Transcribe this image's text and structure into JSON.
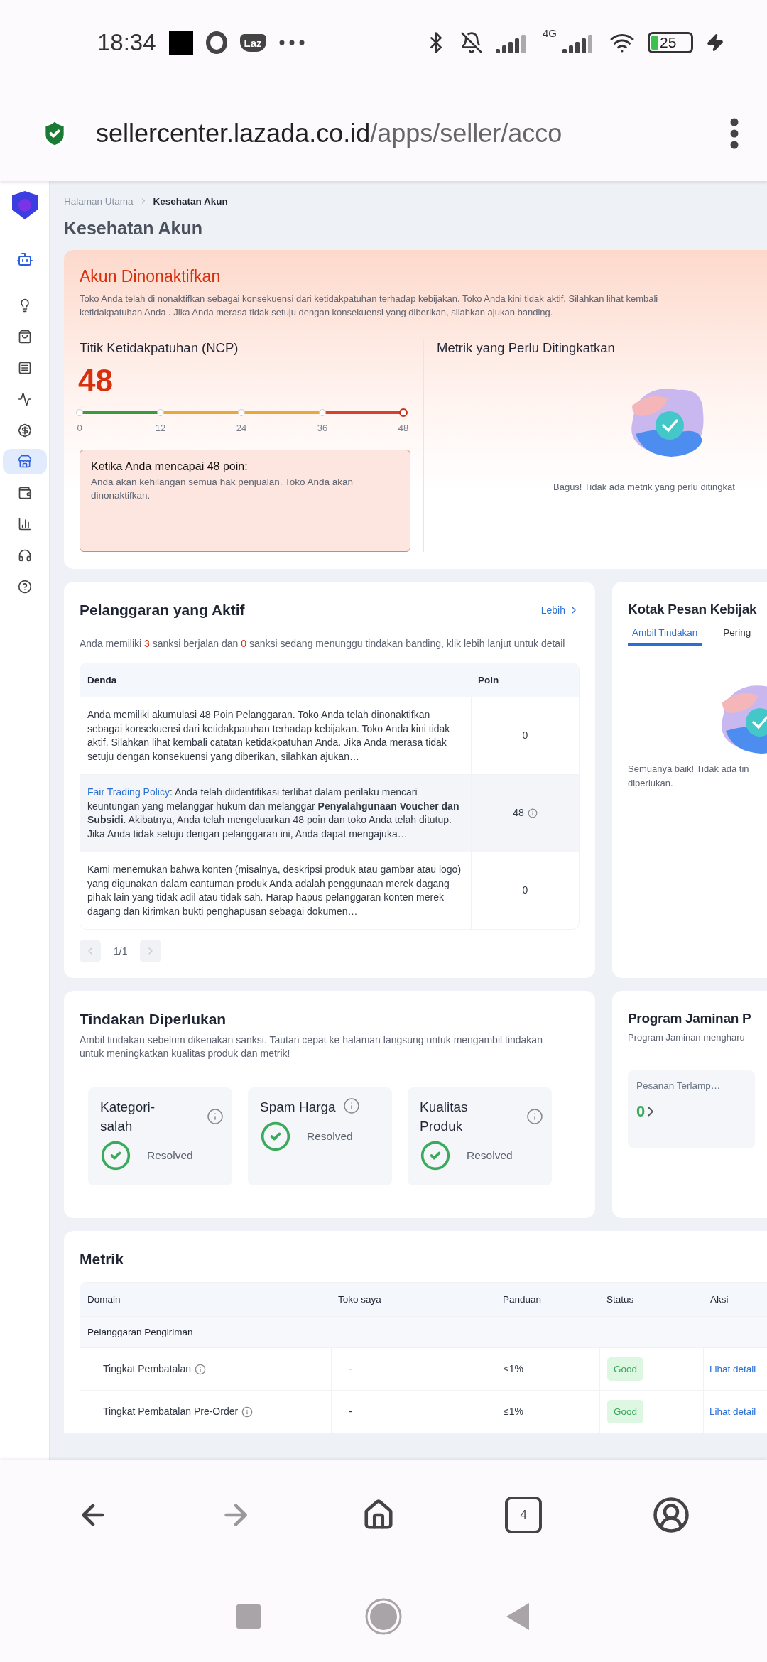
{
  "status_bar": {
    "time": "18:34",
    "app_badge": "Laz",
    "network_label": "4G",
    "battery": "25"
  },
  "address_bar": {
    "host": "sellercenter.lazada.co.id",
    "path": "/apps/seller/acco"
  },
  "sidebar": {
    "items": [
      {
        "kind": "bulb",
        "selected": false
      },
      {
        "kind": "bag",
        "selected": false
      },
      {
        "kind": "list",
        "selected": false
      },
      {
        "kind": "trend",
        "selected": false
      },
      {
        "kind": "promo",
        "selected": false
      },
      {
        "kind": "store",
        "selected": true
      },
      {
        "kind": "wallet",
        "selected": false
      },
      {
        "kind": "stats",
        "selected": false
      },
      {
        "kind": "support",
        "selected": false
      },
      {
        "kind": "help",
        "selected": false
      }
    ]
  },
  "breadcrumb": [
    "Halaman Utama",
    "Kesehatan Akun"
  ],
  "page_title": "Kesehatan Akun",
  "account_status": {
    "title": "Akun Dinonaktifkan",
    "message_lines": [
      "Toko Anda telah di nonaktifkan sebagai konsekuensi dari ketidakpatuhan terhadap kebijakan. Toko Anda kini tidak aktif. Silahkan lihat kembali",
      "ketidakpatuhan Anda . Jika Anda merasa tidak setuju dengan konsekuensi yang diberikan, silahkan ajukan banding."
    ],
    "ncp": {
      "label": "Titik Ketidakpatuhan (NCP)",
      "value": "48",
      "level": 1,
      "ticks": [
        "0",
        "12",
        "24",
        "36",
        "48"
      ]
    },
    "warning": {
      "title": "Ketika Anda mencapai 48 poin:",
      "text": "Anda akan kehilangan semua hak penjualan. Toko Anda akan dinonaktifkan."
    },
    "metrics_panel": {
      "title": "Metrik yang Perlu Ditingkatkan",
      "empty_text": "Bagus! Tidak ada metrik yang perlu ditingkat"
    }
  },
  "violations": {
    "title": "Pelanggaran yang Aktif",
    "more_link": "Lebih",
    "summary": {
      "before": "Anda memiliki ",
      "active": "3",
      "middle": " sanksi berjalan dan ",
      "pending": "0",
      "after": " sanksi sedang menunggu tindakan banding, klik lebih lanjut untuk detail"
    },
    "columns": [
      "Denda",
      "Poin"
    ],
    "rows": [
      {
        "text": "Anda memiliki akumulasi 48 Poin Pelanggaran. Toko Anda telah dinonaktifkan sebagai konsekuensi dari ketidakpatuhan terhadap kebijakan. Toko Anda kini tidak aktif. Silahkan lihat kembali catatan ketidakpatuhan Anda. Jika Anda merasa tidak setuju dengan konsekuensi yang diberikan, silahkan ajukan…",
        "points": "0",
        "info": false,
        "highlighted": false
      },
      {
        "link": "Fair Trading Policy",
        "text": ": Anda telah diidentifikasi terlibat dalam perilaku mencari keuntungan yang melanggar hukum dan melanggar **Penyalahgunaan Voucher dan Subsidi**. Akibatnya, Anda telah mengeluarkan 48 poin dan toko Anda telah ditutup. Jika Anda tidak setuju dengan pelanggaran ini, Anda dapat mengajuka…",
        "points": "48",
        "info": true,
        "highlighted": true
      },
      {
        "text": "Kami menemukan bahwa konten (misalnya, deskripsi produk atau gambar atau logo) yang digunakan dalam cantuman produk Anda adalah penggunaan merek dagang pihak lain yang tidak adil atau tidak sah. Harap hapus pelanggaran konten merek dagang dan kirimkan bukti penghapusan sebagai dokumen…",
        "points": "0",
        "info": false,
        "highlighted": false
      }
    ],
    "pagination": {
      "page": "1/1",
      "prev_disabled": true,
      "next_disabled": true
    }
  },
  "policy_inbox": {
    "title": "Kotak Pesan Kebijak",
    "tabs": [
      {
        "label": "Ambil Tindakan",
        "selected": true
      },
      {
        "label": "Pering",
        "selected": false
      }
    ],
    "empty_lines": [
      "Semuanya baik! Tidak ada tin",
      "diperlukan."
    ]
  },
  "required_actions": {
    "title": "Tindakan Diperlukan",
    "description": "Ambil tindakan sebelum dikenakan sanksi. Tautan cepat ke halaman langsung untuk mengambil tindakan untuk meningkatkan kualitas produk dan metrik!",
    "items": [
      {
        "title": "Kategori-salah",
        "status": "Resolved",
        "resolved": true,
        "inline_info": false
      },
      {
        "title": "Spam Harga",
        "status": "Resolved",
        "resolved": true,
        "inline_info": true
      },
      {
        "title": "Kualitas Produk",
        "status": "Resolved",
        "resolved": true,
        "inline_info": false
      }
    ]
  },
  "guarantee_program": {
    "title": "Program Jaminan P",
    "description": "Program Jaminan mengharu",
    "tile": {
      "label": "Pesanan Terlamp…",
      "value": "0"
    }
  },
  "metrics": {
    "title": "Metrik",
    "columns": [
      "Domain",
      "Toko saya",
      "Panduan",
      "Status",
      "Aksi"
    ],
    "groups": [
      {
        "name": "Pelanggaran Pengiriman",
        "rows": [
          {
            "name": "Tingkat Pembatalan",
            "store": "-",
            "guide": "≤1%",
            "status": "Good",
            "kind": "good",
            "action": "Lihat detail"
          },
          {
            "name": "Tingkat Pembatalan Pre-Order",
            "store": "-",
            "guide": "≤1%",
            "status": "Good",
            "kind": "good",
            "action": "Lihat detail"
          }
        ]
      }
    ]
  },
  "browser_nav": {
    "tab_count": "4",
    "forward_disabled": true
  }
}
